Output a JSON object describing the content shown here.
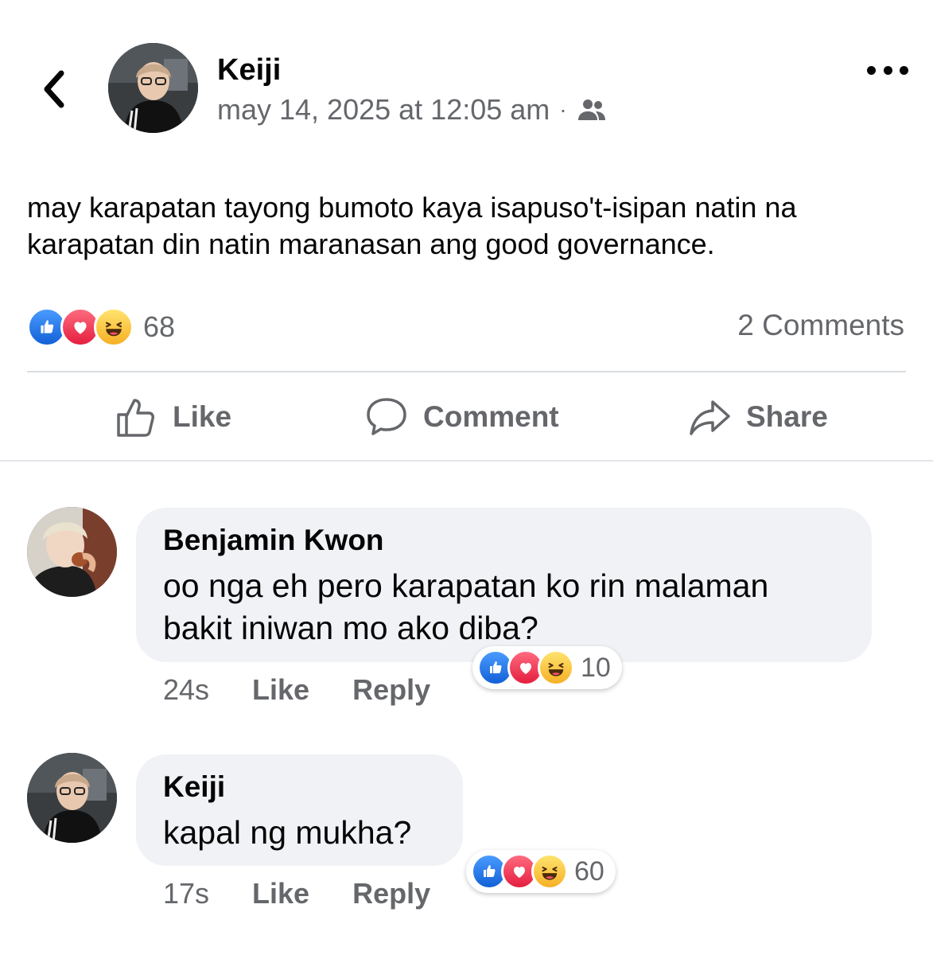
{
  "post": {
    "author": "Keiji",
    "timestamp": "may 14, 2025 at 12:05 am",
    "separator": "·",
    "audience_icon": "friends-icon",
    "text": "may karapatan tayong bumoto kaya isapuso't-isipan natin na karapatan din natin maranasan ang good governance.",
    "reactions": [
      "like",
      "love",
      "haha"
    ],
    "reaction_count": "68",
    "comments_label": "2 Comments"
  },
  "actions": {
    "like": "Like",
    "comment": "Comment",
    "share": "Share"
  },
  "comments": [
    {
      "name": "Benjamin Kwon",
      "text_line1": "oo nga eh pero karapatan ko rin malaman",
      "text_line2": "bakit iniwan mo ako diba?",
      "time": "24s",
      "like_label": "Like",
      "reply_label": "Reply",
      "reactions": [
        "like",
        "love",
        "haha"
      ],
      "reaction_count": "10"
    },
    {
      "name": "Keiji",
      "text_line1": "kapal ng mukha?",
      "time": "17s",
      "like_label": "Like",
      "reply_label": "Reply",
      "reactions": [
        "like",
        "love",
        "haha"
      ],
      "reaction_count": "60"
    }
  ],
  "colors": {
    "like_blue": "#1877f2",
    "love_red": "#e41e3f",
    "haha_yellow": "#f7b125",
    "secondary_text": "#65676b",
    "bubble_bg": "#f0f2f5"
  }
}
